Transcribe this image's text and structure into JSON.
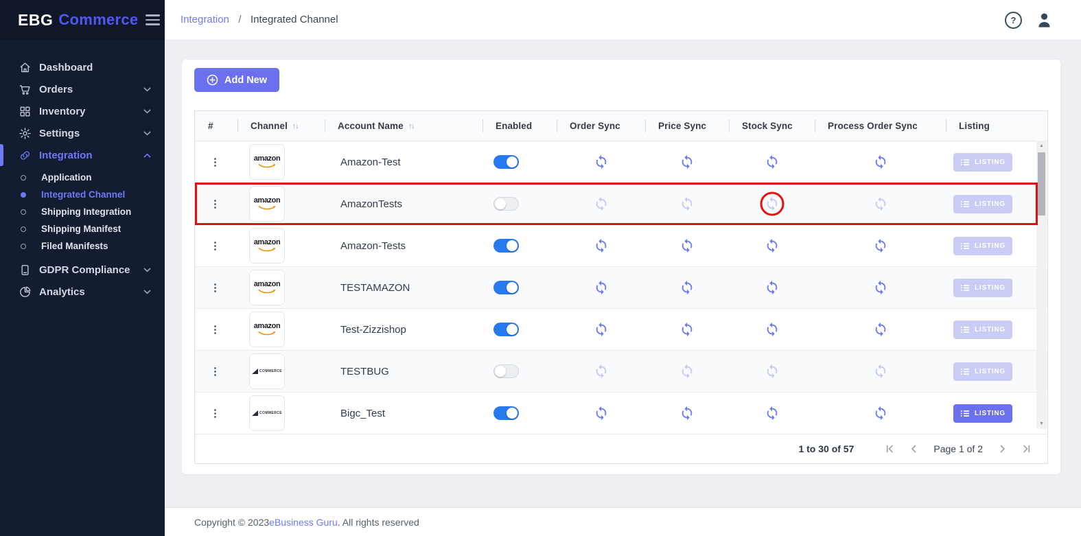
{
  "brand": {
    "name_bold": "EBG",
    "name_light": "Commerce"
  },
  "breadcrumb": {
    "parent": "Integration",
    "separator": "/",
    "current": "Integrated Channel"
  },
  "sidebar": {
    "items": [
      {
        "label": "Dashboard",
        "icon": "home"
      },
      {
        "label": "Orders",
        "icon": "cart",
        "expandable": true
      },
      {
        "label": "Inventory",
        "icon": "grid",
        "expandable": true
      },
      {
        "label": "Settings",
        "icon": "gear",
        "expandable": true
      },
      {
        "label": "Integration",
        "icon": "link",
        "expandable": true,
        "active": true,
        "expanded": true
      }
    ],
    "integration_children": [
      {
        "label": "Application",
        "active": false
      },
      {
        "label": "Integrated Channel",
        "active": true
      },
      {
        "label": "Shipping Integration",
        "active": false
      },
      {
        "label": "Shipping Manifest",
        "active": false
      },
      {
        "label": "Filed Manifests",
        "active": false
      }
    ],
    "items_after": [
      {
        "label": "GDPR Compliance",
        "icon": "document",
        "expandable": true
      },
      {
        "label": "Analytics",
        "icon": "pie",
        "expandable": true
      }
    ]
  },
  "toolbar": {
    "add_new_label": "Add New"
  },
  "channels": {
    "amazon": {
      "label": "amazon"
    },
    "bigcommerce": {
      "label": "COMMERCE"
    }
  },
  "table": {
    "columns": [
      {
        "label": "#",
        "sortable": false
      },
      {
        "label": "Channel",
        "sortable": true
      },
      {
        "label": "Account Name",
        "sortable": true
      },
      {
        "label": "Enabled",
        "sortable": false
      },
      {
        "label": "Order Sync",
        "sortable": false
      },
      {
        "label": "Price Sync",
        "sortable": false
      },
      {
        "label": "Stock Sync",
        "sortable": false
      },
      {
        "label": "Process Order Sync",
        "sortable": false
      },
      {
        "label": "Listing",
        "sortable": false
      }
    ],
    "listing_label": "LISTING",
    "rows": [
      {
        "channel": "amazon",
        "account": "Amazon-Test",
        "enabled": true,
        "sync_active": true,
        "listing_style": "faded"
      },
      {
        "channel": "amazon",
        "account": "AmazonTests",
        "enabled": false,
        "sync_active": false,
        "listing_style": "faded",
        "annotated": true
      },
      {
        "channel": "amazon",
        "account": "Amazon-Tests",
        "enabled": true,
        "sync_active": true,
        "listing_style": "faded"
      },
      {
        "channel": "amazon",
        "account": "TESTAMAZON",
        "enabled": true,
        "sync_active": true,
        "listing_style": "faded"
      },
      {
        "channel": "amazon",
        "account": "Test-Zizzishop",
        "enabled": true,
        "sync_active": true,
        "listing_style": "faded"
      },
      {
        "channel": "bigcommerce",
        "account": "TESTBUG",
        "enabled": false,
        "sync_active": false,
        "listing_style": "faded"
      },
      {
        "channel": "bigcommerce",
        "account": "Bigc_Test",
        "enabled": true,
        "sync_active": true,
        "listing_style": "solid"
      }
    ]
  },
  "annotation": {
    "type": "red-highlight",
    "row_account": "AmazonTests",
    "circled_column": "Stock Sync",
    "color": "#e60f0f"
  },
  "pagination": {
    "range_label": "1 to 30 of 57",
    "page_label": "Page 1 of 2"
  },
  "footer": {
    "prefix": "Copyright © 2023 ",
    "link_text": "eBusiness Guru",
    "suffix": ". All rights reserved"
  },
  "icons": {
    "kebab": "⋮",
    "sort": "↑↓",
    "help": "?",
    "scroll_up": "▲",
    "scroll_down": "▼"
  },
  "colors": {
    "accent": "#6b71ee",
    "toggle_on": "#2779f0",
    "sidebar_bg": "#141c31",
    "annotation_red": "#e60f0f"
  }
}
